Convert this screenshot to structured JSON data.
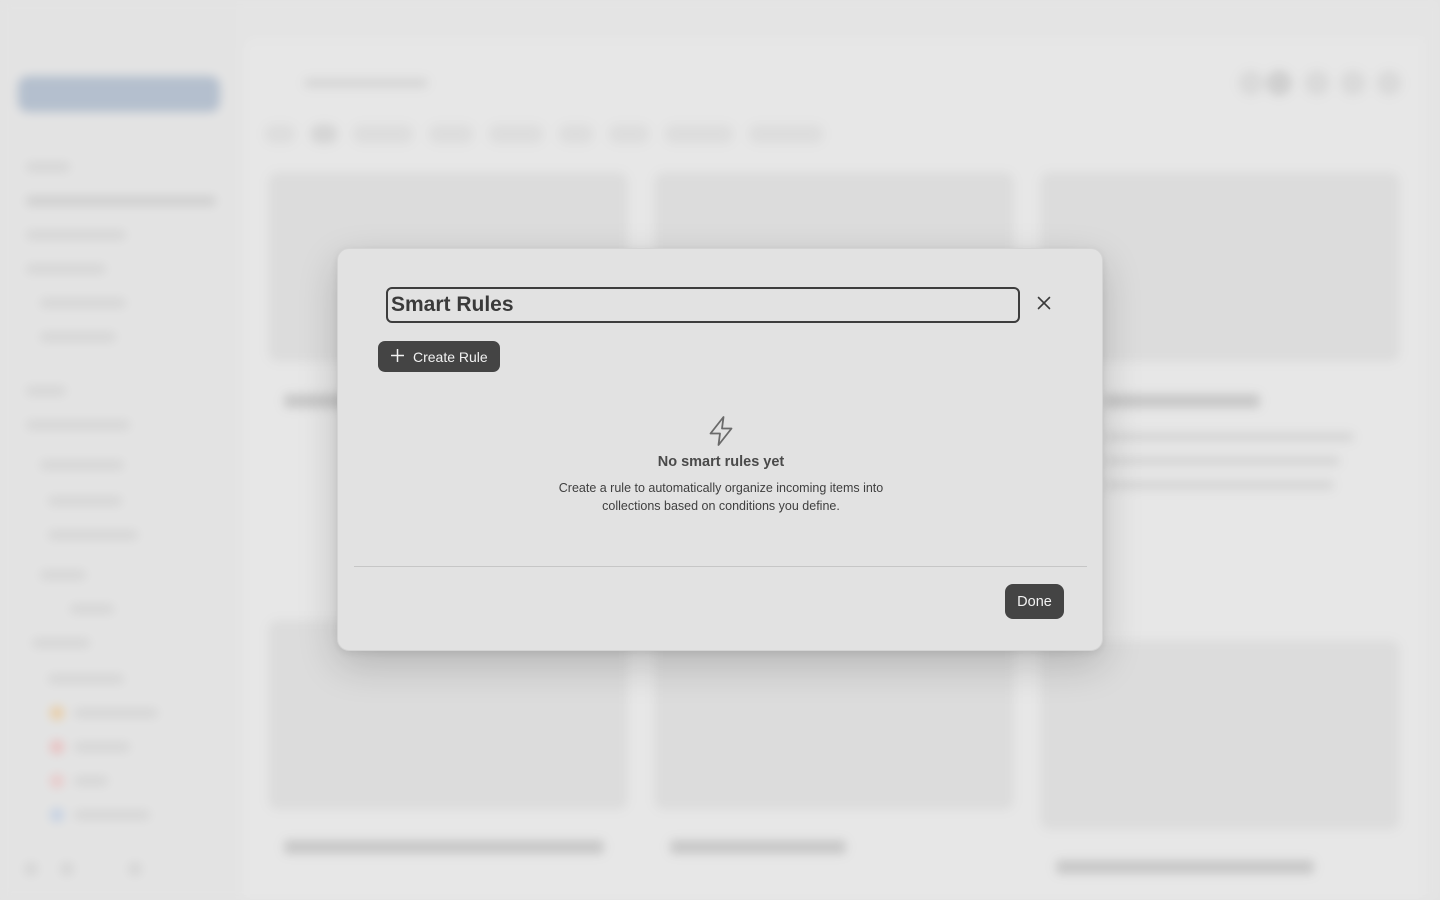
{
  "modal": {
    "title_value": "Smart Rules",
    "close_icon": "close-icon",
    "create_rule": {
      "icon": "plus-icon",
      "label": "Create Rule"
    },
    "empty_state": {
      "icon": "lightning-bolt-icon",
      "title": "No smart rules yet",
      "description": "Create a rule to automatically organize incoming items into collections based on conditions you define."
    },
    "done_label": "Done"
  },
  "colors": {
    "button_bg": "#444444",
    "modal_bg": "#e2e2e2",
    "input_border": "#3d3d3d"
  }
}
